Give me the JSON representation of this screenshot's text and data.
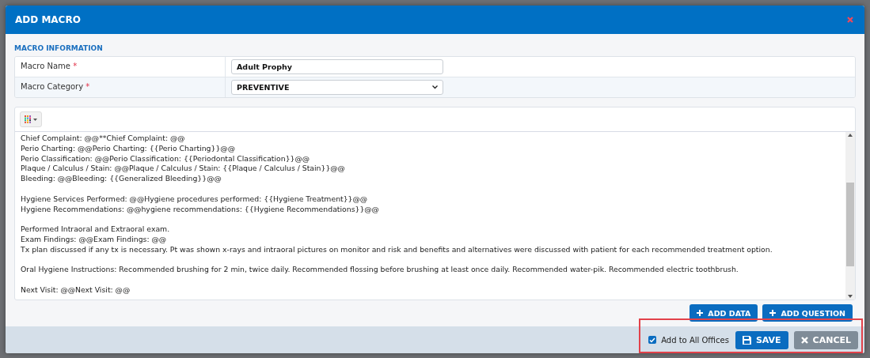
{
  "dialog": {
    "title": "ADD MACRO"
  },
  "section_title": "MACRO INFORMATION",
  "fields": [
    {
      "kind": "text",
      "label": "Macro Name",
      "required_mark": "*",
      "value": "Adult Prophy"
    },
    {
      "kind": "select",
      "label": "Macro Category",
      "required_mark": "*",
      "value": "PREVENTIVE"
    }
  ],
  "editor": {
    "paragraphs": [
      [
        "Chief Complaint: @@**Chief Complaint: @@",
        "Perio Charting: @@Perio Charting: {{Perio Charting}}@@",
        "Perio Classification: @@Perio Classification: {{Periodontal Classification}}@@",
        "Plaque / Calculus / Stain: @@Plaque / Calculus / Stain: {{Plaque / Calculus / Stain}}@@",
        "Bleeding: @@Bleeding: {{Generalized Bleeding}}@@"
      ],
      [
        "Hygiene Services Performed: @@Hygiene procedures performed: {{Hygiene Treatment}}@@",
        "Hygiene Recommendations: @@hygiene recommendations: {{Hygiene Recommendations}}@@"
      ],
      [
        "Performed Intraoral and Extraoral exam.",
        "Exam Findings: @@Exam Findings: @@",
        "Tx plan discussed if any tx is necessary.  Pt was shown x-rays and intraoral pictures on monitor and risk and benefits and alternatives were discussed with patient for each recommended treatment option."
      ],
      [
        "Oral Hygiene Instructions: Recommended brushing for 2 min, twice daily. Recommended flossing before brushing at least once daily. Recommended water-pik. Recommended electric toothbrush."
      ],
      [
        "Next Visit: @@Next Visit: @@"
      ]
    ]
  },
  "editor_buttons": [
    {
      "label": "ADD DATA"
    },
    {
      "label": "ADD QUESTION"
    }
  ],
  "footer": {
    "checkbox": {
      "label": "Add to All Offices",
      "checked": true
    },
    "buttons": [
      {
        "kind": "save",
        "label": "SAVE"
      },
      {
        "kind": "cancel",
        "label": "CANCEL"
      }
    ]
  }
}
